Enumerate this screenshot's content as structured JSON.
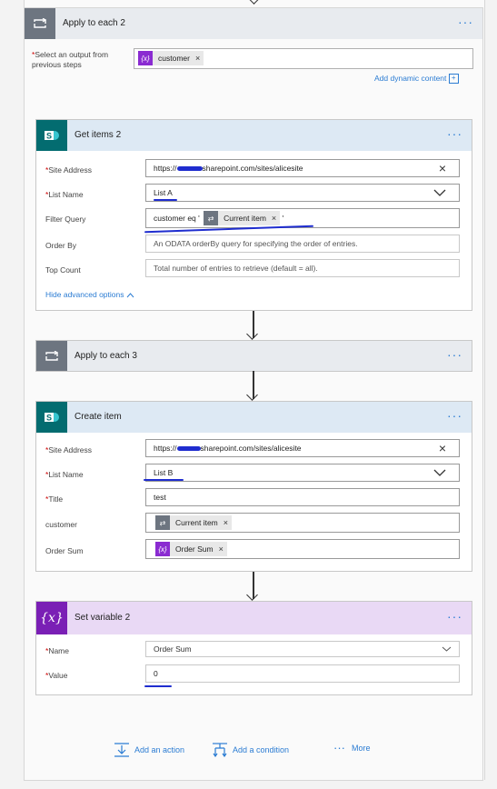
{
  "apply_each_2": {
    "title": "Apply to each 2",
    "select_label": "Select an output from previous steps",
    "token": "customer",
    "add_dynamic": "Add dynamic content"
  },
  "get_items_2": {
    "title": "Get items 2",
    "site_label": "Site Address",
    "site_value": "https://[redacted].sharepoint.com/sites/alicesite",
    "site_prefix": "https://",
    "site_suffix": "sharepoint.com/sites/alicesite",
    "list_label": "List Name",
    "list_value": "List A",
    "filter_label": "Filter Query",
    "filter_text": "customer eq '",
    "filter_token": "Current item",
    "filter_end": "'",
    "order_label": "Order By",
    "order_placeholder": "An ODATA orderBy query for specifying the order of entries.",
    "top_label": "Top Count",
    "top_placeholder": "Total number of entries to retrieve (default = all).",
    "hide_advanced": "Hide advanced options"
  },
  "apply_each_3": {
    "title": "Apply to each 3"
  },
  "create_item": {
    "title": "Create item",
    "site_label": "Site Address",
    "site_prefix": "https://",
    "site_suffix": "sharepoint.com/sites/alicesite",
    "list_label": "List Name",
    "list_value": "List B",
    "title_label": "Title",
    "title_value": "test",
    "customer_label": "customer",
    "customer_token": "Current item",
    "order_sum_label": "Order Sum",
    "order_sum_token": "Order Sum"
  },
  "set_variable_2": {
    "title": "Set variable 2",
    "name_label": "Name",
    "name_value": "Order Sum",
    "value_label": "Value",
    "value_value": "0"
  },
  "footer": {
    "add_action": "Add an action",
    "add_condition": "Add a condition",
    "more": "More"
  },
  "glyphs": {
    "fx": "{x}",
    "fx_big": "{x}",
    "close": "×",
    "dots": "···",
    "caret": "^"
  },
  "colors": {
    "loop_header": "#e8ebef",
    "loop_icon": "#6d7580",
    "sp_header": "#dde9f4",
    "sp_icon": "#036c70",
    "var_header": "#e9d9f5",
    "var_icon": "#7a1fb5",
    "link": "#2b7cd3"
  }
}
